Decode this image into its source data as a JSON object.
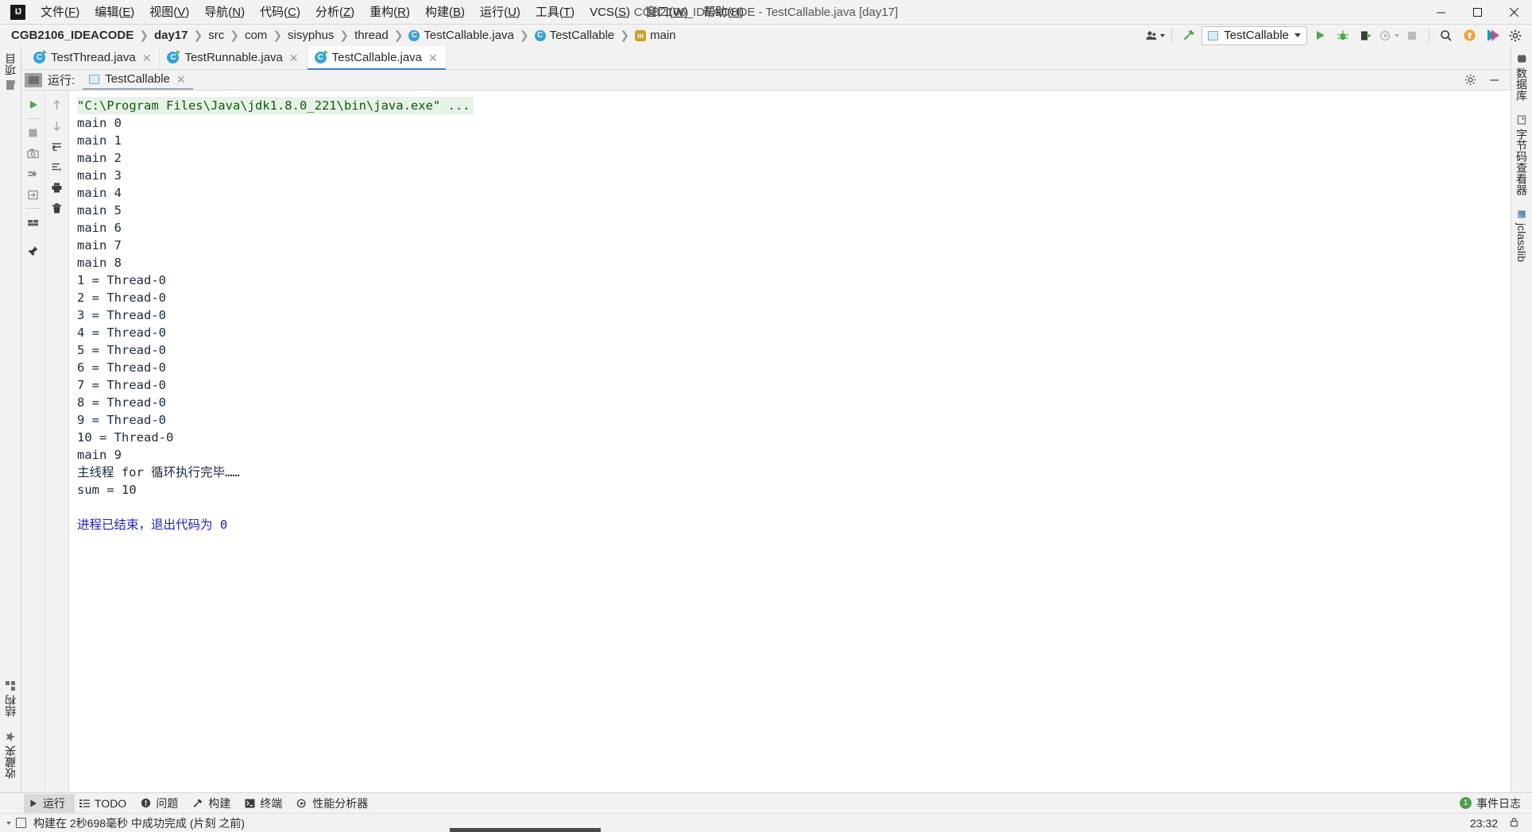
{
  "window": {
    "title": "CGB2106_IDEACODE - TestCallable.java [day17]",
    "logo_text": "IJ",
    "minimize_label": "minimize",
    "maximize_label": "maximize",
    "close_label": "close"
  },
  "menu": {
    "items": [
      {
        "label": "文件",
        "mnemonic": "F"
      },
      {
        "label": "编辑",
        "mnemonic": "E"
      },
      {
        "label": "视图",
        "mnemonic": "V"
      },
      {
        "label": "导航",
        "mnemonic": "N"
      },
      {
        "label": "代码",
        "mnemonic": "C"
      },
      {
        "label": "分析",
        "mnemonic": "Z"
      },
      {
        "label": "重构",
        "mnemonic": "R"
      },
      {
        "label": "构建",
        "mnemonic": "B"
      },
      {
        "label": "运行",
        "mnemonic": "U"
      },
      {
        "label": "工具",
        "mnemonic": "T"
      },
      {
        "label": "VCS",
        "mnemonic": "S"
      },
      {
        "label": "窗口",
        "mnemonic": "W"
      },
      {
        "label": "帮助",
        "mnemonic": "H"
      }
    ]
  },
  "breadcrumbs": [
    {
      "label": "CGB2106_IDEACODE",
      "icon": "none",
      "bold": true
    },
    {
      "label": "day17",
      "icon": "none",
      "bold": true
    },
    {
      "label": "src",
      "icon": "none",
      "bold": false
    },
    {
      "label": "com",
      "icon": "none",
      "bold": false
    },
    {
      "label": "sisyphus",
      "icon": "none",
      "bold": false
    },
    {
      "label": "thread",
      "icon": "none",
      "bold": false
    },
    {
      "label": "TestCallable.java",
      "icon": "java-class-icon",
      "bold": false
    },
    {
      "label": "TestCallable",
      "icon": "java-class-icon",
      "bold": false
    },
    {
      "label": "main",
      "icon": "method-icon",
      "bold": false
    }
  ],
  "toolbar": {
    "user_icon": "user-avatar-icon",
    "build_icon": "hammer-build-icon",
    "run_config": {
      "label": "TestCallable",
      "icon": "run-config-icon",
      "dropdown_icon": "chevron-down-icon"
    },
    "run_icon": "run-play-icon",
    "debug_icon": "debug-bug-icon",
    "run_coverage_icon": "run-with-coverage-icon",
    "profile_icon": "profiler-icon",
    "stop_icon": "stop-square-icon",
    "search_icon": "search-icon",
    "update_icon": "update-project-icon",
    "plugins_icon": "plugins-icon",
    "settings_icon": "settings-gear-icon"
  },
  "editor_tabs": [
    {
      "label": "TestThread.java",
      "icon": "java-class-icon",
      "active": false
    },
    {
      "label": "TestRunnable.java",
      "icon": "java-class-icon",
      "active": false
    },
    {
      "label": "TestCallable.java",
      "icon": "java-class-icon",
      "active": true
    }
  ],
  "run_window": {
    "title": "运行:",
    "tab_label": "TestCallable",
    "tab_icon": "run-config-icon",
    "close_icon": "close-icon",
    "settings_icon": "settings-gear-icon",
    "hide_icon": "hide-window-icon",
    "left_toolbar": [
      {
        "name": "rerun-button",
        "icon": "run-play-icon"
      },
      {
        "name": "stop-button",
        "icon": "stop-square-icon"
      },
      {
        "name": "screenshot-button",
        "icon": "camera-icon"
      },
      {
        "name": "dump-threads-button",
        "icon": "thread-dump-icon"
      },
      {
        "name": "exit-button",
        "icon": "exit-arrow-icon"
      },
      {
        "name": "layout-button",
        "icon": "layout-icon"
      },
      {
        "name": "pin-button",
        "icon": "pin-icon"
      }
    ],
    "right_toolbar": [
      {
        "name": "scroll-up-button",
        "icon": "arrow-up-icon"
      },
      {
        "name": "scroll-down-button",
        "icon": "arrow-down-icon"
      },
      {
        "name": "soft-wrap-button",
        "icon": "soft-wrap-icon"
      },
      {
        "name": "scroll-to-end-button",
        "icon": "scroll-to-end-icon"
      },
      {
        "name": "print-button",
        "icon": "printer-icon"
      },
      {
        "name": "clear-all-button",
        "icon": "trash-icon"
      }
    ]
  },
  "console": {
    "command_line": "\"C:\\Program Files\\Java\\jdk1.8.0_221\\bin\\java.exe\" ...",
    "lines": [
      {
        "text": "main 0",
        "style": "normal"
      },
      {
        "text": "main 1",
        "style": "normal"
      },
      {
        "text": "main 2",
        "style": "normal"
      },
      {
        "text": "main 3",
        "style": "normal"
      },
      {
        "text": "main 4",
        "style": "normal"
      },
      {
        "text": "main 5",
        "style": "normal"
      },
      {
        "text": "main 6",
        "style": "normal"
      },
      {
        "text": "main 7",
        "style": "normal"
      },
      {
        "text": "main 8",
        "style": "normal"
      },
      {
        "text": "1 = Thread-0",
        "style": "normal"
      },
      {
        "text": "2 = Thread-0",
        "style": "normal"
      },
      {
        "text": "3 = Thread-0",
        "style": "normal"
      },
      {
        "text": "4 = Thread-0",
        "style": "normal"
      },
      {
        "text": "5 = Thread-0",
        "style": "normal"
      },
      {
        "text": "6 = Thread-0",
        "style": "normal"
      },
      {
        "text": "7 = Thread-0",
        "style": "normal"
      },
      {
        "text": "8 = Thread-0",
        "style": "normal"
      },
      {
        "text": "9 = Thread-0",
        "style": "normal"
      },
      {
        "text": "10 = Thread-0",
        "style": "normal"
      },
      {
        "text": "main 9",
        "style": "normal"
      },
      {
        "text": "主线程 for 循环执行完毕……",
        "style": "normal"
      },
      {
        "text": "sum = 10",
        "style": "normal"
      },
      {
        "text": "",
        "style": "blank"
      },
      {
        "text": "进程已结束，退出代码为 0",
        "style": "blue"
      }
    ]
  },
  "left_tool_buttons": [
    {
      "label": "项目",
      "icon": "project-icon"
    },
    {
      "label": "结构",
      "icon": "structure-icon"
    },
    {
      "label": "收藏夹",
      "icon": "favorites-icon"
    }
  ],
  "right_tool_buttons": [
    {
      "label": "数据库",
      "icon": "database-icon"
    },
    {
      "label": "字节码查看器",
      "icon": "bytecode-viewer-icon"
    },
    {
      "label": "jclasslib",
      "icon": "jclasslib-icon"
    }
  ],
  "project_tab": {
    "label": "项目",
    "icon": "project-folder-icon",
    "dropdown_icon": "chevron-down-icon"
  },
  "status_bar": {
    "items": [
      {
        "label": "运行",
        "icon": "run-play-icon",
        "selected": true
      },
      {
        "label": "TODO",
        "icon": "todo-list-icon",
        "selected": false
      },
      {
        "label": "问题",
        "icon": "problems-icon",
        "selected": false
      },
      {
        "label": "构建",
        "icon": "hammer-build-icon",
        "selected": false
      },
      {
        "label": "终端",
        "icon": "terminal-icon",
        "selected": false
      },
      {
        "label": "性能分析器",
        "icon": "profiler-icon",
        "selected": false
      }
    ],
    "event_log": {
      "label": "事件日志",
      "count": "1",
      "icon": "event-log-icon"
    }
  },
  "status_bar2": {
    "message": "构建在 2秒698毫秒 中成功完成 (片刻 之前)",
    "message_icon": "build-status-icon",
    "time": "23:32",
    "lock_icon": "lock-icon"
  }
}
